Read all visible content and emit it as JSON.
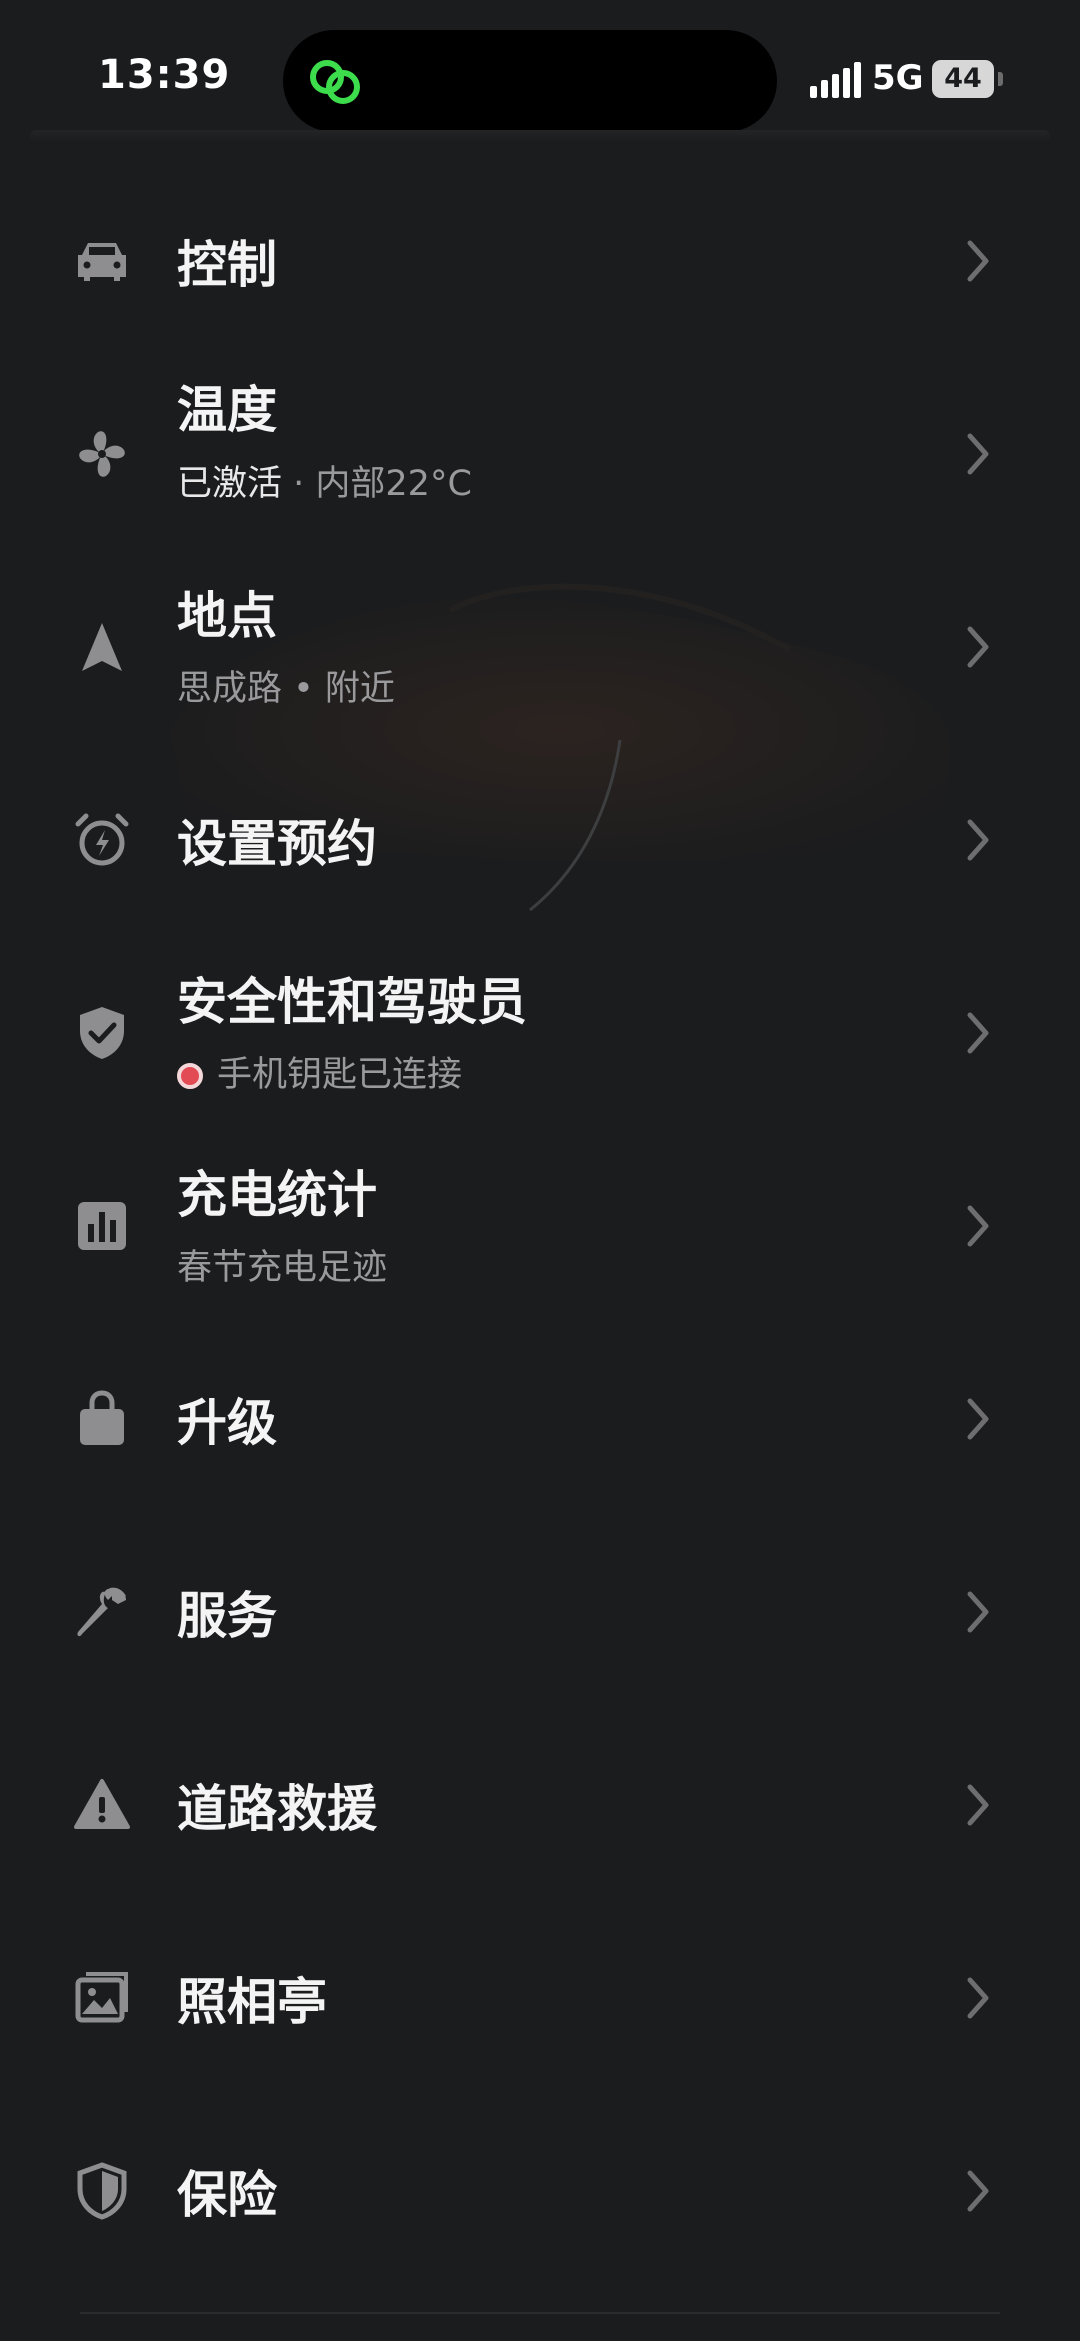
{
  "status_bar": {
    "time": "13:39",
    "network": "5G",
    "battery": "44"
  },
  "menu": {
    "items": [
      {
        "icon": "car-icon",
        "title": "控制",
        "sub": ""
      },
      {
        "icon": "fan-icon",
        "title": "温度",
        "sub_strong": "已激活",
        "sub_sep": " · ",
        "sub_rest": "内部22°C"
      },
      {
        "icon": "navigation-arrow-icon",
        "title": "地点",
        "sub": "思成路 • 附近"
      },
      {
        "icon": "alarm-clock-bolt-icon",
        "title": "设置预约",
        "sub": ""
      },
      {
        "icon": "shield-check-icon",
        "title": "安全性和驾驶员",
        "sub": "手机钥匙已连接"
      },
      {
        "icon": "bar-chart-icon",
        "title": "充电统计",
        "sub": "春节充电足迹"
      },
      {
        "icon": "shopping-bag-icon",
        "title": "升级",
        "sub": ""
      },
      {
        "icon": "wrench-icon",
        "title": "服务",
        "sub": ""
      },
      {
        "icon": "warning-triangle-icon",
        "title": "道路救援",
        "sub": ""
      },
      {
        "icon": "photo-gallery-icon",
        "title": "照相亭",
        "sub": ""
      },
      {
        "icon": "shield-icon",
        "title": "保险",
        "sub": ""
      }
    ]
  },
  "colors": {
    "background": "#1b1c1e",
    "status_dot": "#e34b54",
    "icon": "#8e8e90",
    "app_icon": "#3ddc4c"
  }
}
